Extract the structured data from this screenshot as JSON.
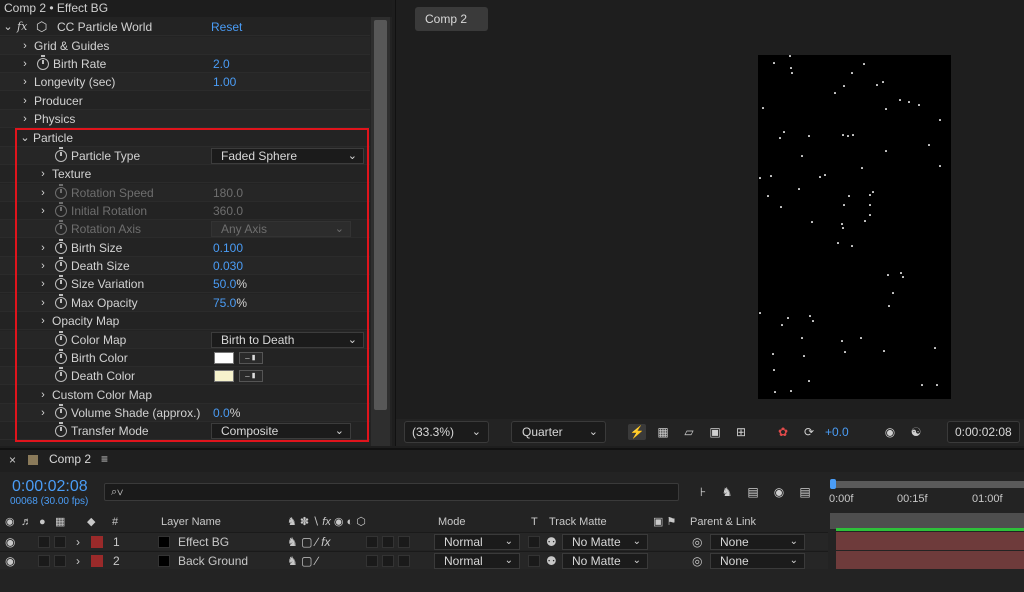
{
  "effect_panel": {
    "title": "Comp 2 • Effect BG",
    "effect_name": "CC Particle World",
    "reset_label": "Reset",
    "rows": {
      "grid": "Grid & Guides",
      "birth_rate": "Birth Rate",
      "birth_rate_val": "2.0",
      "longevity": "Longevity (sec)",
      "longevity_val": "1.00",
      "producer": "Producer",
      "physics": "Physics",
      "particle": "Particle",
      "particle_type": "Particle Type",
      "particle_type_val": "Faded Sphere",
      "texture": "Texture",
      "rotation_speed": "Rotation Speed",
      "rotation_speed_val": "180.0",
      "initial_rotation": "Initial Rotation",
      "initial_rotation_val": "360.0",
      "rotation_axis": "Rotation Axis",
      "rotation_axis_val": "Any Axis",
      "birth_size": "Birth Size",
      "birth_size_val": "0.100",
      "death_size": "Death Size",
      "death_size_val": "0.030",
      "size_variation": "Size Variation",
      "size_variation_val": "50.0",
      "max_opacity": "Max Opacity",
      "max_opacity_val": "75.0",
      "percent": "%",
      "opacity_map": "Opacity Map",
      "color_map": "Color Map",
      "color_map_val": "Birth to Death",
      "birth_color": "Birth Color",
      "death_color": "Death Color",
      "custom_color_map": "Custom Color Map",
      "volume_shade": "Volume Shade (approx.)",
      "volume_shade_val": "0.0",
      "transfer_mode": "Transfer Mode",
      "transfer_mode_val": "Composite"
    },
    "colors": {
      "birth_color": "#ffffff",
      "death_color": "#f6f2cc",
      "highlight": "#e0141c"
    }
  },
  "viewer": {
    "tab": "Comp 2",
    "zoom": "(33.3%)",
    "resolution": "Quarter",
    "exposure": "+0.0",
    "timecode": "0:00:02:08"
  },
  "timeline": {
    "comp_name": "Comp 2",
    "timecode": "0:00:02:08",
    "frame_info": "00068 (30.00 fps)",
    "search_placeholder": "⌕∨",
    "columns": {
      "num": "#",
      "layer_name": "Layer Name",
      "mode": "Mode",
      "t": "T",
      "track_matte": "Track Matte",
      "parent": "Parent & Link"
    },
    "ticks": [
      "0:00f",
      "00:15f",
      "01:00f"
    ],
    "layers": [
      {
        "num": "1",
        "name": "Effect BG",
        "mode": "Normal",
        "matte": "No Matte",
        "parent": "None"
      },
      {
        "num": "2",
        "name": "Back Ground",
        "mode": "Normal",
        "matte": "No Matte",
        "parent": "None"
      }
    ]
  }
}
